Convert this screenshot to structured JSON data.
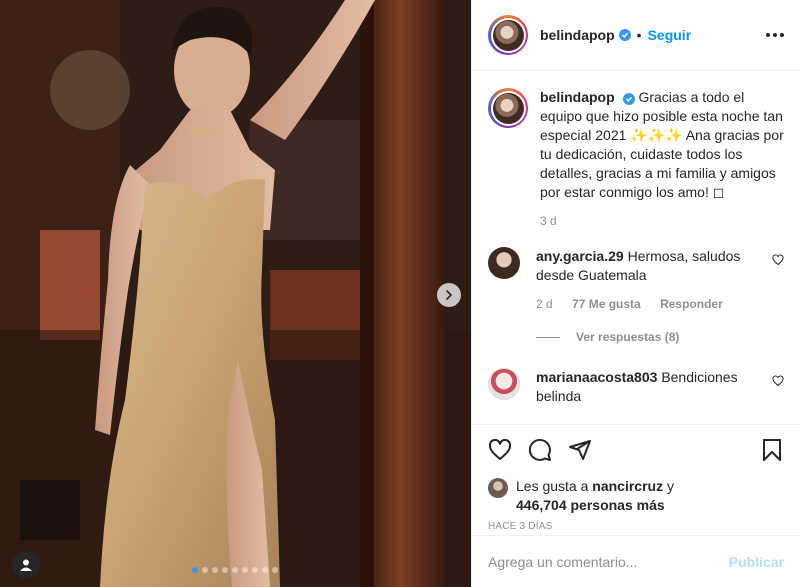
{
  "post_user": {
    "username": "belindapop",
    "follow_label": "Seguir",
    "separator": "•"
  },
  "caption": {
    "username": "belindapop",
    "text": "Gracias a todo el equipo que hizo posible esta noche tan especial 2021 ✨✨✨ Ana gracias por tu dedicación, cuidaste todos los detalles, gracias a mi familia y amigos por estar conmigo los amo! ◻",
    "age": "3 d"
  },
  "comments": [
    {
      "username": "any.garcia.29",
      "text": "Hermosa, saludos desde Guatemala",
      "age": "2 d",
      "likes": "77 Me gusta",
      "reply_label": "Responder",
      "view_replies": "Ver respuestas (8)"
    },
    {
      "username": "marianaacosta803",
      "text": "Bendiciones belinda"
    }
  ],
  "likes": {
    "prefix": "Les gusta a",
    "user": "nancircruz",
    "joiner": "y",
    "count_text": "446,704 personas más"
  },
  "timestamp": "HACE 3 DÍAS",
  "add_comment": {
    "placeholder": "Agrega un comentario...",
    "publish_label": "Publicar"
  },
  "carousel": {
    "total": 9,
    "active_index": 0
  },
  "colors": {
    "accent": "#0095f6",
    "publish_disabled": "#b2dffc",
    "verified": "#3897f0",
    "active_dot": "#2f9bf0"
  },
  "icons": [
    "more-options-icon",
    "verified-badge-icon",
    "heart-icon",
    "comment-icon",
    "share-icon",
    "bookmark-icon",
    "chevron-right-icon",
    "user-tag-icon"
  ]
}
